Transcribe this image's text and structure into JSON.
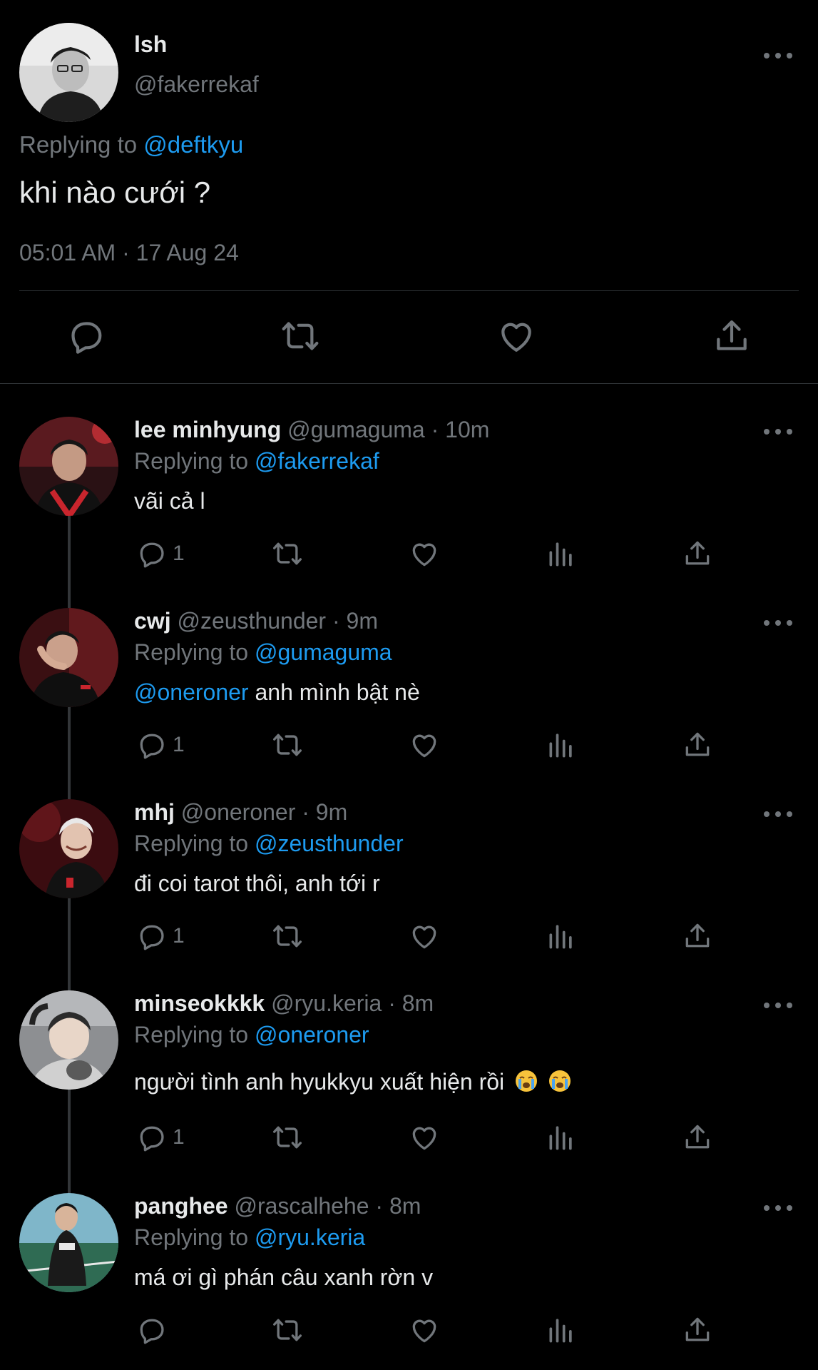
{
  "main_tweet": {
    "name": "lsh",
    "handle": "@fakerrekaf",
    "replying_label": "Replying to",
    "replying_to": "@deftkyu",
    "text": "khi nào cưới ?",
    "timestamp": "05:01 AM · 17 Aug 24",
    "actions": [
      "reply-icon",
      "retweet-icon",
      "like-icon",
      "share-icon"
    ]
  },
  "replies": [
    {
      "name": "lee minhyung",
      "handle": "@gumaguma",
      "time": " · 10m",
      "replying_label": "Replying to",
      "replying_to": "@fakerrekaf",
      "mention": "",
      "text": "vãi cả l",
      "reply_count": "1"
    },
    {
      "name": "cwj",
      "handle": "@zeusthunder",
      "time": " · 9m",
      "replying_label": "Replying to",
      "replying_to": "@gumaguma",
      "mention": "@oneroner",
      "text": " anh mình bật nè",
      "reply_count": "1"
    },
    {
      "name": "mhj",
      "handle": "@oneroner",
      "time": " · 9m",
      "replying_label": "Replying to",
      "replying_to": "@zeusthunder",
      "mention": "",
      "text": "đi coi tarot thôi, anh tới r",
      "reply_count": "1"
    },
    {
      "name": "minseokkkk",
      "handle": "@ryu.keria",
      "time": " · 8m",
      "replying_label": "Replying to",
      "replying_to": "@oneroner",
      "mention": "",
      "text": "người tình anh hyukkyu xuất hiện rồi",
      "reply_count": "1",
      "emojis": [
        "loudly-crying-face-emoji",
        "loudly-crying-face-emoji"
      ]
    },
    {
      "name": "panghee",
      "handle": "@rascalhehe",
      "time": " · 8m",
      "replying_label": "Replying to",
      "replying_to": "@ryu.keria",
      "mention": "",
      "text": "má ơi gì phán câu xanh rờn v",
      "reply_count": ""
    }
  ],
  "colors": {
    "background": "#000000",
    "text": "#e7e9ea",
    "secondary": "#71767b",
    "link": "#1d9bf0",
    "divider": "#2f3336"
  }
}
